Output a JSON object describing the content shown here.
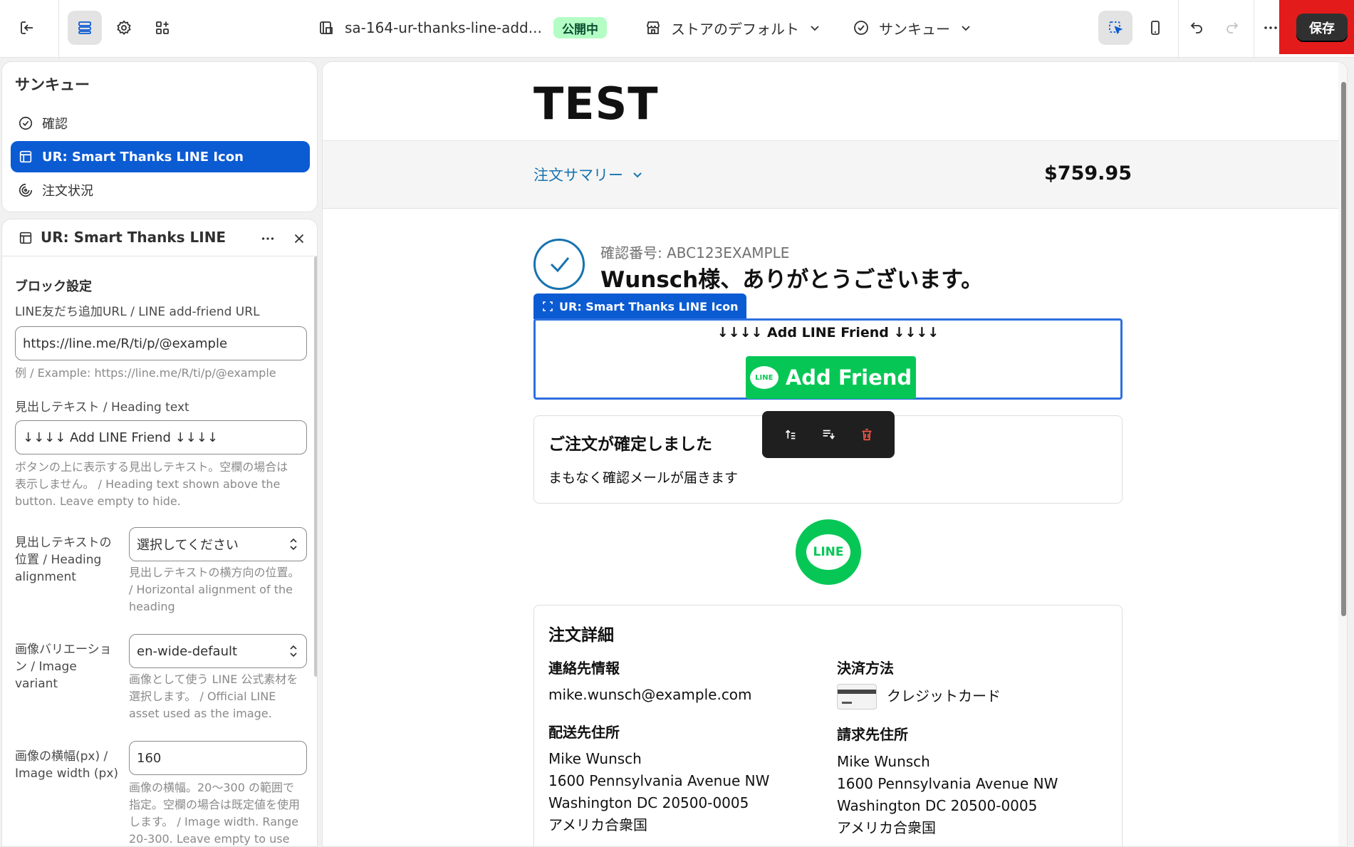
{
  "topbar": {
    "theme_name": "sa-164-ur-thanks-line-add...",
    "status_badge": "公開中",
    "market_label": "ストアのデフォルト",
    "page_label": "サンキュー",
    "save_label": "保存"
  },
  "nav": {
    "title": "サンキュー",
    "items": [
      {
        "label": "確認",
        "icon": "check-circle-icon"
      },
      {
        "label": "UR: Smart Thanks LINE Icon",
        "icon": "block-layout-icon"
      },
      {
        "label": "注文状況",
        "icon": "order-status-icon"
      }
    ]
  },
  "settings": {
    "header_title": "UR: Smart Thanks LINE Icon",
    "section_title": "ブロック設定",
    "url_label": "LINE友だち追加URL / LINE add-friend URL",
    "url_value": "https://line.me/R/ti/p/@example",
    "url_help": "例 / Example: https://line.me/R/ti/p/@example",
    "heading_label": "見出しテキスト / Heading text",
    "heading_value": "↓↓↓↓ Add LINE Friend ↓↓↓↓",
    "heading_help_1": "ボタンの上に表示する見出しテキスト。空欄の場合は",
    "heading_help_2": "表示しません。 / Heading text shown above the",
    "heading_help_3": "button. Leave empty to hide.",
    "align_label_1": "見出しテキストの",
    "align_label_2": "位置 / Heading",
    "align_label_3": "alignment",
    "align_value": "選択してください",
    "align_help_1": "見出しテキストの横方向の位置。",
    "align_help_2": "/ Horizontal alignment of the",
    "align_help_3": "heading",
    "variant_label_1": "画像バリエーショ",
    "variant_label_2": "ン / Image",
    "variant_label_3": "variant",
    "variant_value": "en-wide-default",
    "variant_help_1": "画像として使う LINE 公式素材を",
    "variant_help_2": "選択します。 / Official LINE",
    "variant_help_3": "asset used as the image.",
    "width_label_1": "画像の横幅(px) /",
    "width_label_2": "Image width (px)",
    "width_value": "160",
    "width_help_1": "画像の横幅。20〜300 の範囲で",
    "width_help_2": "指定。空欄の場合は既定値を使用",
    "width_help_3": "します。 / Image width. Range",
    "width_help_4": "20-300. Leave empty to use"
  },
  "preview": {
    "shop_name": "TEST",
    "summary_link": "注文サマリー",
    "total": "$759.95",
    "confirmation": "確認番号: ABC123EXAMPLE",
    "thanks": "Wunsch様、ありがとうございます。",
    "block_tag": "UR: Smart Thanks LINE Icon",
    "block_heading": "↓↓↓↓ Add LINE Friend ↓↓↓↓",
    "add_friend": "Add Friend",
    "line_text": "LINE",
    "order_confirmed": "ご注文が確定しました",
    "email_soon": "まもなく確認メールが届きます",
    "details_title": "注文詳細",
    "contact_title": "連絡先情報",
    "contact_email": "mike.wunsch@example.com",
    "payment_title": "決済方法",
    "payment_method": "クレジットカード",
    "shipping_title": "配送先住所",
    "shipping": [
      "Mike Wunsch",
      "1600 Pennsylvania Avenue NW",
      "Washington DC 20500-0005",
      "アメリカ合衆国"
    ],
    "billing_title": "請求先住所",
    "billing": [
      "Mike Wunsch",
      "1600 Pennsylvania Avenue NW",
      "Washington DC 20500-0005",
      "アメリカ合衆国"
    ]
  },
  "colors": {
    "accent": "#0b5bd3",
    "line_green": "#06c755",
    "link": "#1773b0",
    "save_highlight": "#e41b1b"
  }
}
